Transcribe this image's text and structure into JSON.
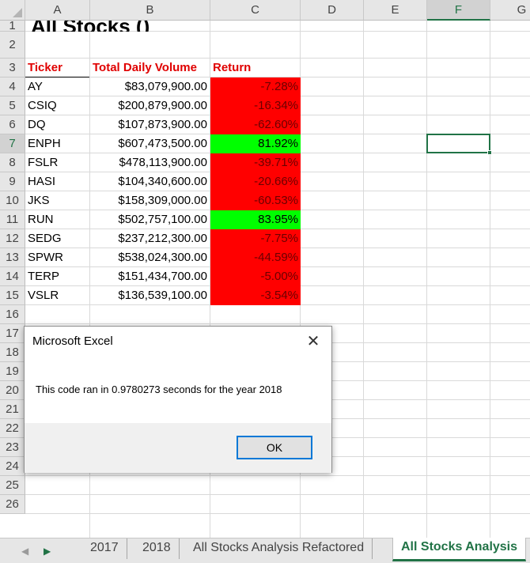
{
  "columns": [
    "A",
    "B",
    "C",
    "D",
    "E",
    "F",
    "G"
  ],
  "rows": [
    "1",
    "2",
    "3",
    "4",
    "5",
    "6",
    "7",
    "8",
    "9",
    "10",
    "11",
    "12",
    "13",
    "14",
    "15",
    "16",
    "17",
    "18",
    "19",
    "20",
    "21",
    "22",
    "23",
    "24",
    "25",
    "26"
  ],
  "sheet": {
    "title": "All Stocks ()",
    "headers": {
      "ticker": "Ticker",
      "volume": "Total Daily Volume",
      "return": "Return"
    },
    "records": [
      {
        "ticker": "AY",
        "volume": "$83,079,900.00",
        "return": "-7.28%",
        "status": "neg"
      },
      {
        "ticker": "CSIQ",
        "volume": "$200,879,900.00",
        "return": "-16.34%",
        "status": "neg"
      },
      {
        "ticker": "DQ",
        "volume": "$107,873,900.00",
        "return": "-62.60%",
        "status": "neg"
      },
      {
        "ticker": "ENPH",
        "volume": "$607,473,500.00",
        "return": "81.92%",
        "status": "pos"
      },
      {
        "ticker": "FSLR",
        "volume": "$478,113,900.00",
        "return": "-39.71%",
        "status": "neg"
      },
      {
        "ticker": "HASI",
        "volume": "$104,340,600.00",
        "return": "-20.66%",
        "status": "neg"
      },
      {
        "ticker": "JKS",
        "volume": "$158,309,000.00",
        "return": "-60.53%",
        "status": "neg"
      },
      {
        "ticker": "RUN",
        "volume": "$502,757,100.00",
        "return": "83.95%",
        "status": "pos"
      },
      {
        "ticker": "SEDG",
        "volume": "$237,212,300.00",
        "return": "-7.75%",
        "status": "neg"
      },
      {
        "ticker": "SPWR",
        "volume": "$538,024,300.00",
        "return": "-44.59%",
        "status": "neg"
      },
      {
        "ticker": "TERP",
        "volume": "$151,434,700.00",
        "return": "-5.00%",
        "status": "neg"
      },
      {
        "ticker": "VSLR",
        "volume": "$136,539,100.00",
        "return": "-3.54%",
        "status": "neg"
      }
    ]
  },
  "selection": {
    "column": "F",
    "row": "7"
  },
  "tabs": [
    {
      "label": "2017",
      "active": false
    },
    {
      "label": "2018",
      "active": false
    },
    {
      "label": "All Stocks Analysis Refactored",
      "active": false
    },
    {
      "label": "All Stocks Analysis",
      "active": true
    }
  ],
  "dialog": {
    "title": "Microsoft Excel",
    "message": "This code ran in 0.9780273 seconds for the year 2018",
    "ok_label": "OK"
  },
  "colors": {
    "accent": "#217346",
    "negative": "#ff0000",
    "positive": "#00ff00",
    "header_text": "#e00000"
  },
  "icons": {
    "close": "close-icon",
    "nav_left": "chevron-left-icon",
    "nav_right": "chevron-right-icon"
  }
}
